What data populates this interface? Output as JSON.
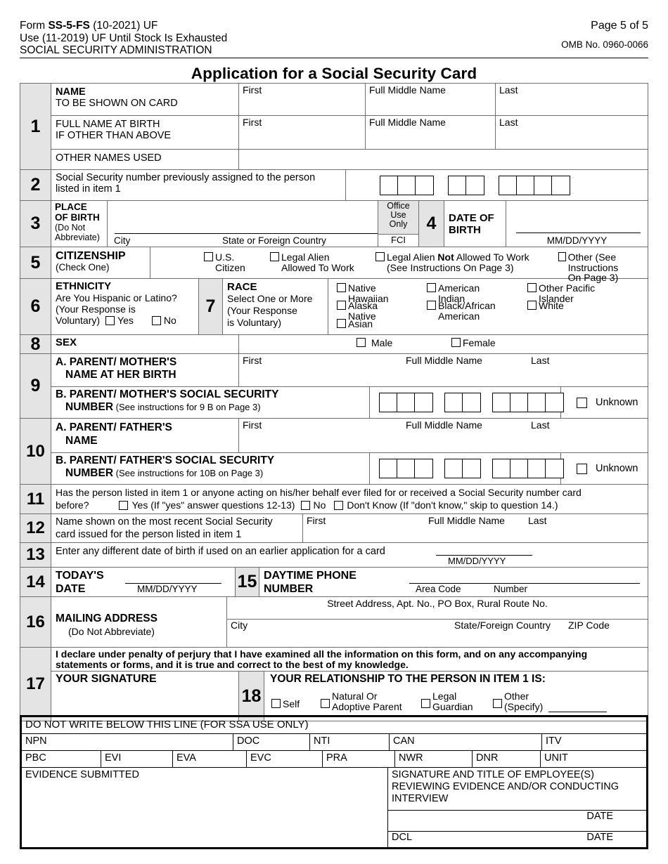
{
  "header": {
    "line1_prefix": "Form ",
    "line1_bold": "SS-5-FS",
    "line1_suffix": " (10-2021) UF",
    "line2": "Use (11-2019) UF Until Stock Is Exhausted",
    "line3": "SOCIAL SECURITY ADMINISTRATION",
    "page": "Page 5 of 5",
    "omb": "OMB No. 0960-0066",
    "title": "Application for a Social Security Card"
  },
  "columns": {
    "first": "First",
    "middle": "Full Middle Name",
    "last": "Last"
  },
  "item1": {
    "num": "1",
    "name_title": "NAME",
    "name_sub": "TO BE SHOWN ON CARD",
    "birth_l1": "FULL NAME AT BIRTH",
    "birth_l2": "IF OTHER THAN ABOVE",
    "other_names": "OTHER NAMES USED"
  },
  "item2": {
    "num": "2",
    "l1": "Social Security number previously assigned to the person",
    "l2": "listed in item 1",
    "ssn_groups": [
      3,
      2,
      4
    ]
  },
  "item3": {
    "num": "3",
    "t1": "PLACE",
    "t2": "OF BIRTH",
    "t3": "(Do Not",
    "t4": "Abbreviate)",
    "city": "City",
    "state": "State or Foreign Country",
    "office_use": "Office Use Only",
    "office_use_lines": [
      "Office",
      "Use",
      "Only"
    ],
    "fci": "FCI"
  },
  "item4": {
    "num": "4",
    "t1": "DATE OF",
    "t2": "BIRTH",
    "format": "MM/DD/YYYY"
  },
  "item5": {
    "num": "5",
    "title": "CITIZENSHIP",
    "sub": "(Check One)",
    "options": [
      {
        "l1": "U.S.",
        "l2": "Citizen"
      },
      {
        "l1": "Legal Alien",
        "l2": "Allowed To Work"
      },
      {
        "l1": "Legal Alien Not Allowed To Work",
        "l1_pre": "Legal Alien ",
        "l1_bold": "Not",
        "l1_post": " Allowed To Work",
        "l2": "(See Instructions On Page 3)"
      },
      {
        "l1": "Other (See Instructions",
        "l2": "On Page 3)"
      }
    ]
  },
  "item6": {
    "num": "6",
    "title": "ETHNICITY",
    "l1": "Are You Hispanic or Latino?",
    "l2": "(Your Response is",
    "l3": "Voluntary)",
    "yes": "Yes",
    "no": "No"
  },
  "item7": {
    "num": "7",
    "title": "RACE",
    "l1": "Select One or More",
    "l2": "(Your Response",
    "l3": "is Voluntary)",
    "options_col1": [
      {
        "l1": "Native",
        "l2": "Hawaiian"
      },
      {
        "l1": "Alaska",
        "l2": "Native"
      },
      {
        "l1": "Asian",
        "l2": ""
      }
    ],
    "options_col2": [
      {
        "l1": "American",
        "l2": "Indian"
      },
      {
        "l1": "Black/African",
        "l2": "American"
      }
    ],
    "options_col3": [
      {
        "l1": "Other Pacific",
        "l2": "Islander"
      },
      {
        "l1": "White",
        "l2": ""
      }
    ]
  },
  "item8": {
    "num": "8",
    "title": "SEX",
    "male": "Male",
    "female": "Female"
  },
  "item9": {
    "num": "9",
    "a_l1": "A. PARENT/ MOTHER'S",
    "a_l2": "NAME AT HER BIRTH",
    "b_l1": "B. PARENT/ MOTHER'S SOCIAL SECURITY",
    "b_l2_bold": "NUMBER",
    "b_l2_rest": " (See instructions for 9 B on Page 3)",
    "ssn_groups": [
      3,
      2,
      4
    ],
    "unknown": "Unknown"
  },
  "item10": {
    "num": "10",
    "a_l1": "A. PARENT/ FATHER'S",
    "a_l2": "NAME",
    "b_l1": "B. PARENT/ FATHER'S SOCIAL SECURITY",
    "b_l2_bold": "NUMBER",
    "b_l2_rest": " (See instructions for 10B on Page 3)",
    "ssn_groups": [
      3,
      2,
      4
    ],
    "unknown": "Unknown"
  },
  "item11": {
    "num": "11",
    "l1": "Has the person listed in item 1 or anyone acting on his/her behalf ever filed for or received a Social Security number card",
    "before": "before?",
    "yes": "Yes (If \"yes\" answer questions 12-13)",
    "no": "No",
    "dont_know": "Don't Know (If \"don't know,\" skip to question 14.)"
  },
  "item12": {
    "num": "12",
    "l1": "Name shown on the most recent Social Security",
    "l2": "card issued for the person listed in item 1"
  },
  "item13": {
    "num": "13",
    "text": "Enter any different date of birth if used on an earlier application for a card",
    "format": "MM/DD/YYYY"
  },
  "item14": {
    "num": "14",
    "t1": "TODAY'S",
    "t2": "DATE",
    "format": "MM/DD/YYYY"
  },
  "item15": {
    "num": "15",
    "t1": "DAYTIME PHONE",
    "t2": "NUMBER",
    "area_code": "Area Code",
    "number": "Number"
  },
  "item16": {
    "num": "16",
    "t1": "MAILING ADDRESS",
    "t2": "(Do Not Abbreviate)",
    "street": "Street Address, Apt. No., PO Box, Rural Route No.",
    "city": "City",
    "state": "State/Foreign Country",
    "zip": "ZIP Code"
  },
  "declaration": {
    "l1": "I declare under penalty of perjury that I have examined all the information on this form, and on any accompanying",
    "l2": "statements or forms, and it is true and correct to the best of my knowledge."
  },
  "item17": {
    "num": "17",
    "title": "YOUR SIGNATURE"
  },
  "item18": {
    "num": "18",
    "title": "YOUR RELATIONSHIP TO THE PERSON IN ITEM 1 IS:",
    "options": [
      {
        "l1": "Self",
        "l2": ""
      },
      {
        "l1": "Natural Or",
        "l2": "Adoptive Parent"
      },
      {
        "l1": "Legal",
        "l2": "Guardian"
      },
      {
        "l1": "Other",
        "l2": "(Specify)"
      }
    ]
  },
  "ssa_use": {
    "banner": "DO NOT WRITE BELOW THIS LINE (FOR SSA USE ONLY)",
    "row1": [
      "NPN",
      "DOC",
      "NTI",
      "CAN",
      "ITV"
    ],
    "row2": [
      "PBC",
      "EVI",
      "EVA",
      "EVC",
      "PRA",
      "NWR",
      "DNR",
      "UNIT"
    ],
    "evidence": "EVIDENCE SUBMITTED",
    "sig_l1": "SIGNATURE AND TITLE OF EMPLOYEE(S)",
    "sig_l2": "REVIEWING EVIDENCE AND/OR CONDUCTING",
    "sig_l3": "INTERVIEW",
    "date1": "DATE",
    "dcl": "DCL",
    "date2": "DATE"
  }
}
